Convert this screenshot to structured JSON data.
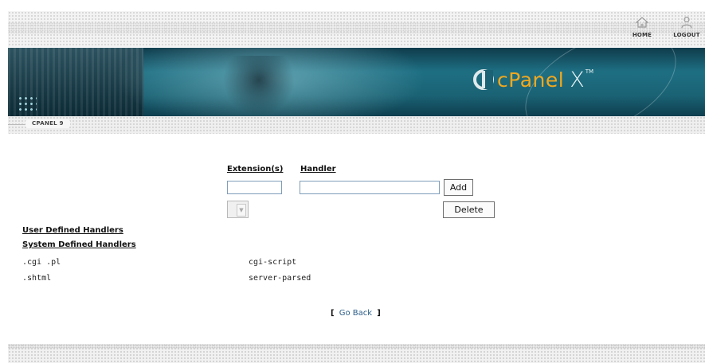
{
  "header": {
    "home_label": "HOME",
    "logout_label": "LOGOUT",
    "home_icon": "home-icon",
    "logout_icon": "user-icon"
  },
  "banner": {
    "logo_text": "cPanel",
    "logo_x": "X",
    "logo_tm": "TM",
    "brand_color": "#f2a81d",
    "banner_color": "#1e6f83"
  },
  "breadcrumb": {
    "label": "CPANEL 9"
  },
  "form": {
    "extension_header": "Extension(s)",
    "handler_header": "Handler",
    "extension_value": "",
    "handler_value": "",
    "add_label": "Add",
    "delete_label": "Delete",
    "select_value": ""
  },
  "sections": {
    "user_defined_title": "User Defined Handlers",
    "system_defined_title": "System Defined Handlers"
  },
  "system_handlers": [
    {
      "extensions": ".cgi .pl",
      "handler": "cgi-script"
    },
    {
      "extensions": ".shtml",
      "handler": "server-parsed"
    }
  ],
  "footer_nav": {
    "open_bracket": "[",
    "go_back_label": "Go Back",
    "close_bracket": "]",
    "link_color": "#2a5d86"
  }
}
